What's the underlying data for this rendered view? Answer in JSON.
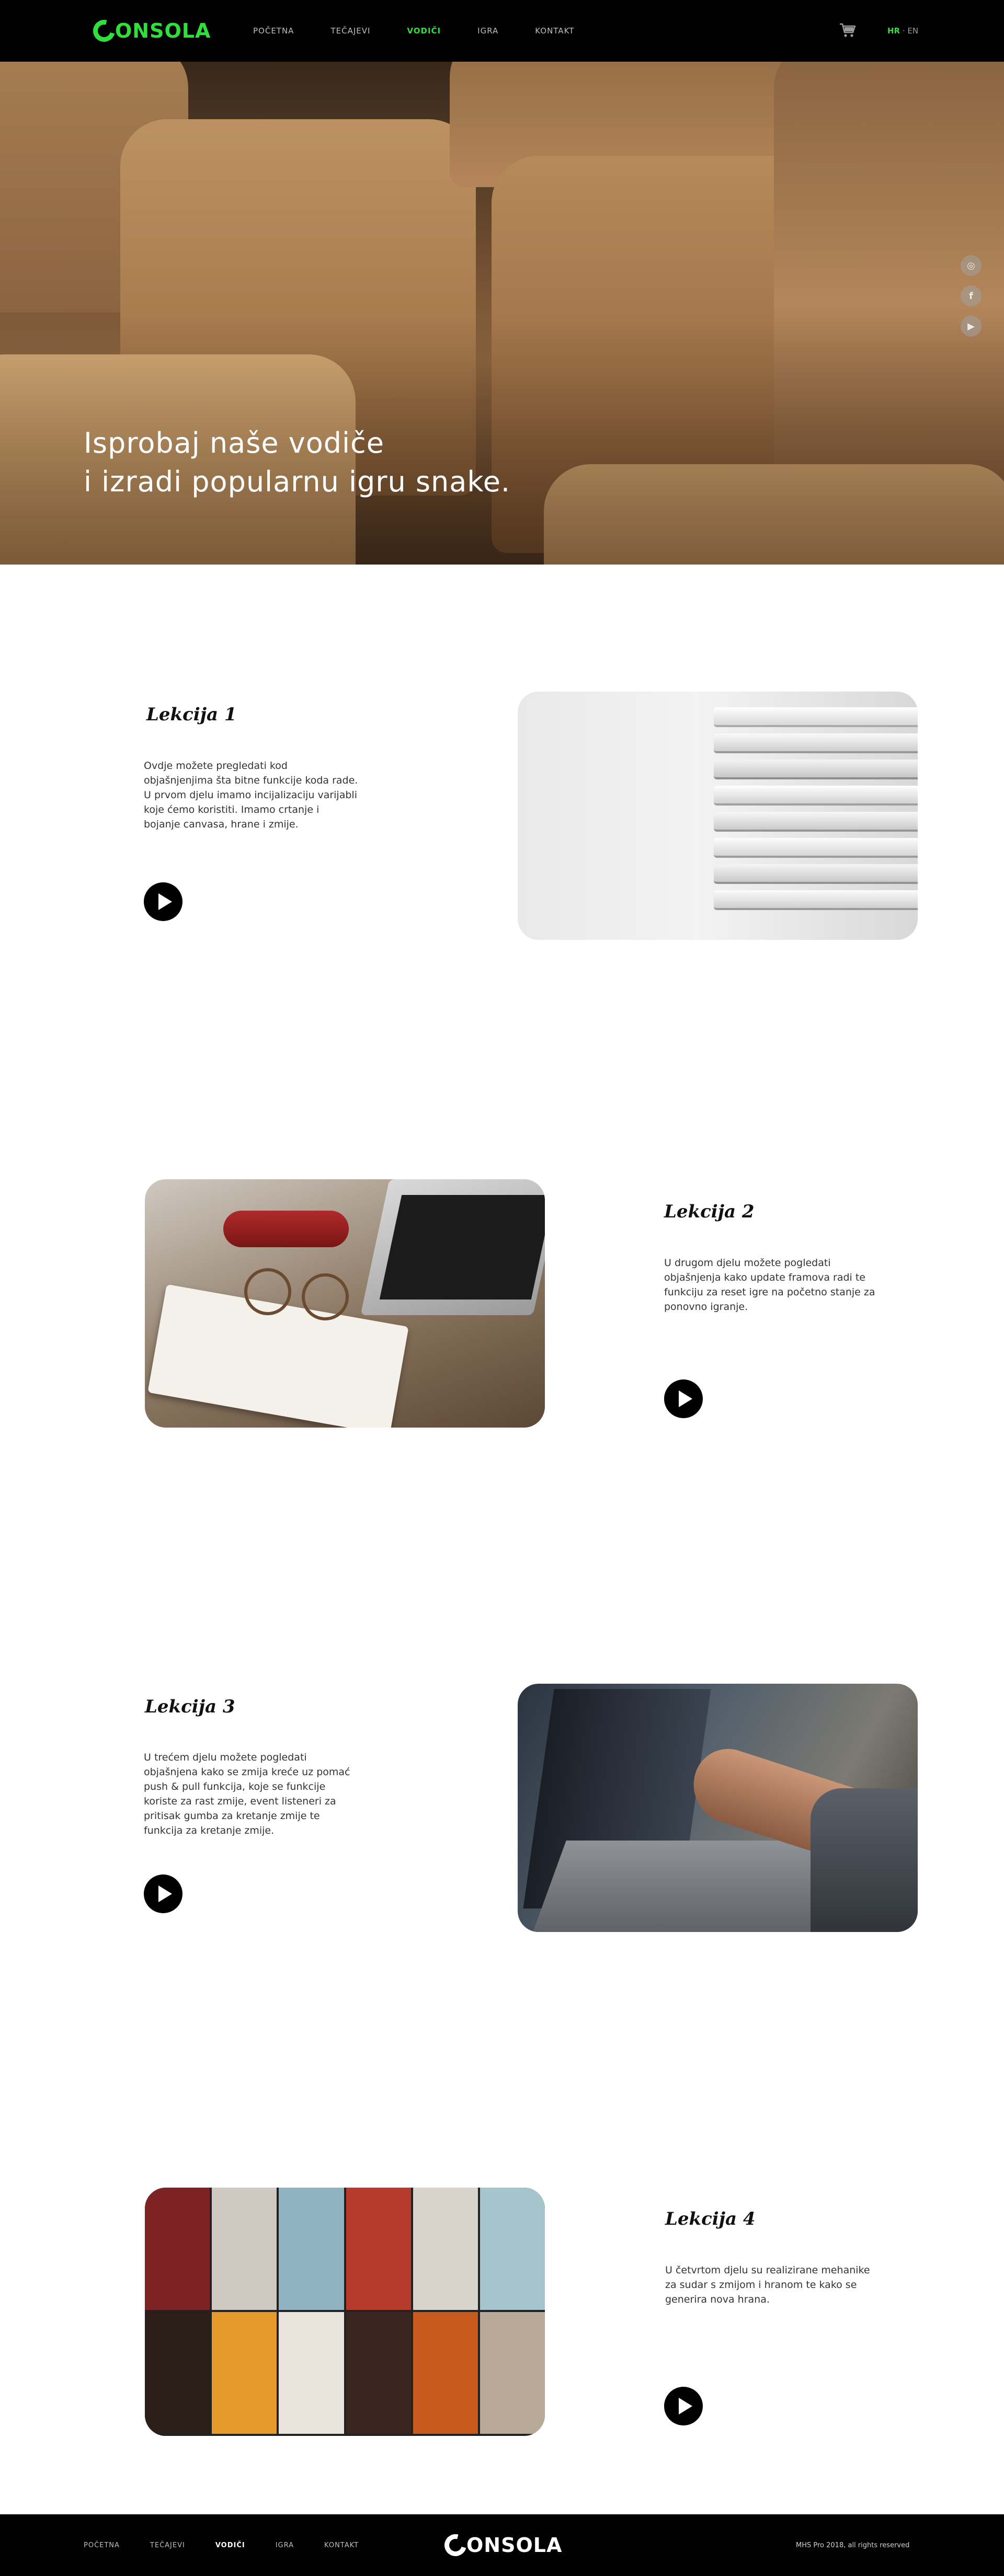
{
  "header": {
    "logo_text": "ONSOLA",
    "nav": [
      "POČETNA",
      "TEČAJEVI",
      "VODIČI",
      "IGRA",
      "KONTAKT"
    ],
    "active_nav": "VODIČI",
    "lang_hr": "HR",
    "lang_sep": " · ",
    "lang_en": "EN",
    "accent_color": "#2fe03a"
  },
  "hero": {
    "title_line1": "Isprobaj naše vodiče",
    "title_line2": "i izradi popularnu igru snake.",
    "social_icons": [
      "instagram-icon",
      "facebook-icon",
      "youtube-icon"
    ]
  },
  "lessons": [
    {
      "title": "Lekcija 1",
      "text": "Ovdje možete pregledati kod objašnjenjima šta bitne funkcije koda rade. U prvom djelu imamo incijalizaciju varijabli koje ćemo koristiti. Imamo crtanje i bojanje canvasa, hrane i zmije."
    },
    {
      "title": "Lekcija 2",
      "text": "U drugom djelu možete pogledati objašnjenja kako update framova radi te funkciju za reset igre na početno stanje za ponovno igranje."
    },
    {
      "title": "Lekcija 3",
      "text": "U trećem djelu možete pogledati objašnjena kako se zmija kreće uz pomać push & pull funkcija, koje se funkcije koriste za rast zmije, event listeneri za pritisak gumba za kretanje zmije te funkcija za kretanje zmije."
    },
    {
      "title": "Lekcija 4",
      "text": "U četvrtom djelu su realizirane mehanike za sudar s zmijom i hranom te kako se generira nova hrana."
    }
  ],
  "footer": {
    "nav": [
      "POČETNA",
      "TEČAJEVI",
      "VODIČI",
      "IGRA",
      "KONTAKT"
    ],
    "active_nav": "VODIČI",
    "logo_text": "ONSOLA",
    "copyright": "MHS Pro 2018, all rights reserved"
  }
}
